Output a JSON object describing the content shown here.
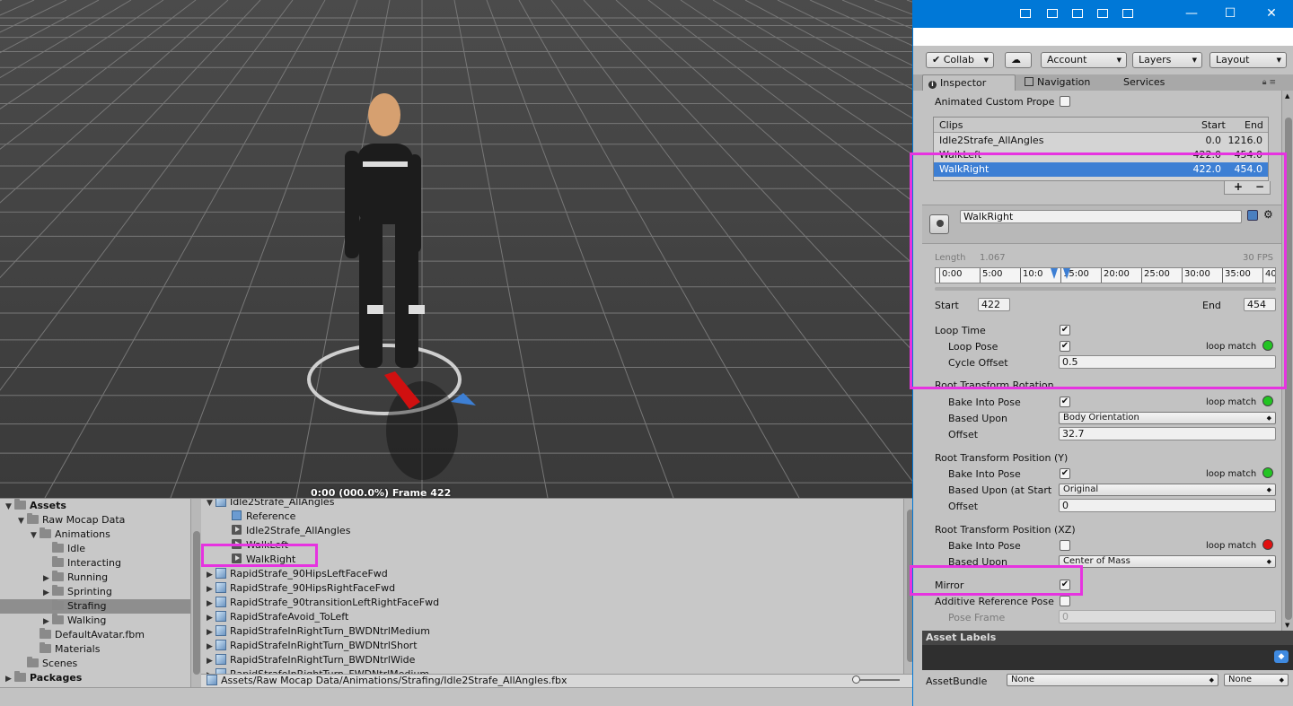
{
  "scene": {
    "frame_readout": "0:00 (000.0%) Frame 422"
  },
  "project": {
    "tree": [
      {
        "label": "Assets",
        "level": 0,
        "arrow": "▼",
        "bold": true
      },
      {
        "label": "Raw Mocap Data",
        "level": 1,
        "arrow": "▼"
      },
      {
        "label": "Animations",
        "level": 2,
        "arrow": "▼"
      },
      {
        "label": "Idle",
        "level": 3,
        "arrow": ""
      },
      {
        "label": "Interacting",
        "level": 3,
        "arrow": ""
      },
      {
        "label": "Running",
        "level": 3,
        "arrow": "▶"
      },
      {
        "label": "Sprinting",
        "level": 3,
        "arrow": "▶"
      },
      {
        "label": "Strafing",
        "level": 3,
        "arrow": "",
        "selected": true
      },
      {
        "label": "Walking",
        "level": 3,
        "arrow": "▶"
      },
      {
        "label": "DefaultAvatar.fbm",
        "level": 2,
        "arrow": ""
      },
      {
        "label": "Materials",
        "level": 2,
        "arrow": ""
      },
      {
        "label": "Scenes",
        "level": 1,
        "arrow": ""
      },
      {
        "label": "Packages",
        "level": 0,
        "arrow": "▶",
        "bold": true
      }
    ],
    "files": [
      {
        "label": "Idle2Strafe_AllAngles",
        "kind": "model",
        "indent": 0,
        "arrow": "▼"
      },
      {
        "label": "Reference",
        "kind": "ref",
        "indent": 1,
        "arrow": ""
      },
      {
        "label": "Idle2Strafe_AllAngles",
        "kind": "clip",
        "indent": 1,
        "arrow": ""
      },
      {
        "label": "WalkLeft",
        "kind": "clip",
        "indent": 1,
        "arrow": ""
      },
      {
        "label": "WalkRight",
        "kind": "clip",
        "indent": 1,
        "arrow": ""
      },
      {
        "label": "RapidStrafe_90HipsLeftFaceFwd",
        "kind": "model",
        "indent": 0,
        "arrow": "▶"
      },
      {
        "label": "RapidStrafe_90HipsRightFaceFwd",
        "kind": "model",
        "indent": 0,
        "arrow": "▶"
      },
      {
        "label": "RapidStrafe_90transitionLeftRightFaceFwd",
        "kind": "model",
        "indent": 0,
        "arrow": "▶"
      },
      {
        "label": "RapidStrafeAvoid_ToLeft",
        "kind": "model",
        "indent": 0,
        "arrow": "▶"
      },
      {
        "label": "RapidStrafeInRightTurn_BWDNtrlMedium",
        "kind": "model",
        "indent": 0,
        "arrow": "▶"
      },
      {
        "label": "RapidStrafeInRightTurn_BWDNtrlShort",
        "kind": "model",
        "indent": 0,
        "arrow": "▶"
      },
      {
        "label": "RapidStrafeInRightTurn_BWDNtrlWide",
        "kind": "model",
        "indent": 0,
        "arrow": "▶"
      },
      {
        "label": "RapidStrafeInRightTurn_FWDNtrlMedium",
        "kind": "model",
        "indent": 0,
        "arrow": "▶"
      }
    ],
    "path": "Assets/Raw Mocap Data/Animations/Strafing/Idle2Strafe_AllAngles.fbx"
  },
  "toolbar": {
    "collab": "Collab",
    "account": "Account",
    "layers": "Layers",
    "layout": "Layout"
  },
  "tabs": {
    "inspector": "Inspector",
    "navigation": "Navigation",
    "services": "Services"
  },
  "inspector": {
    "animated_custom_props": "Animated Custom Prope",
    "clips_header": {
      "name": "Clips",
      "start": "Start",
      "end": "End"
    },
    "clips": [
      {
        "name": "Idle2Strafe_AllAngles",
        "start": "0.0",
        "end": "1216.0",
        "selected": false
      },
      {
        "name": "WalkLeft",
        "start": "422.0",
        "end": "454.0",
        "selected": false
      },
      {
        "name": "WalkRight",
        "start": "422.0",
        "end": "454.0",
        "selected": true
      }
    ],
    "plus": "+",
    "minus": "−",
    "clip_name": "WalkRight",
    "length_label": "Length",
    "length_value": "1.067",
    "fps": "30 FPS",
    "timeline_ticks": [
      "0:00",
      "5:00",
      "10:0",
      "15:00",
      "20:00",
      "25:00",
      "30:00",
      "35:00",
      "40"
    ],
    "start_label": "Start",
    "start_value": "422",
    "end_label": "End",
    "end_value": "454",
    "loop_time": "Loop Time",
    "loop_pose": "Loop Pose",
    "loop_match": "loop match",
    "cycle_offset": "Cycle Offset",
    "cycle_offset_value": "0.5",
    "rtr_title": "Root Transform Rotation",
    "bake_into_pose": "Bake Into Pose",
    "based_upon": "Based Upon",
    "rtr_based_value": "Body Orientation",
    "offset": "Offset",
    "rtr_offset_value": "32.7",
    "rty_title": "Root Transform Position (Y)",
    "based_upon_start": "Based Upon (at Start",
    "rty_based_value": "Original",
    "rty_offset_value": "0",
    "rtxz_title": "Root Transform Position (XZ)",
    "rtxz_based_value": "Center of Mass",
    "mirror": "Mirror",
    "additive": "Additive Reference Pose",
    "pose_frame": "Pose Frame",
    "pose_frame_value": "0"
  },
  "asset_labels": {
    "title": "Asset Labels",
    "assetbundle": "AssetBundle",
    "none1": "None",
    "none2": "None"
  },
  "colors": {
    "highlight": "#e633e0",
    "titlebar": "#0078d7",
    "selection": "#3d7fd4",
    "loop_ok": "#22c422",
    "loop_bad": "#e01010"
  }
}
